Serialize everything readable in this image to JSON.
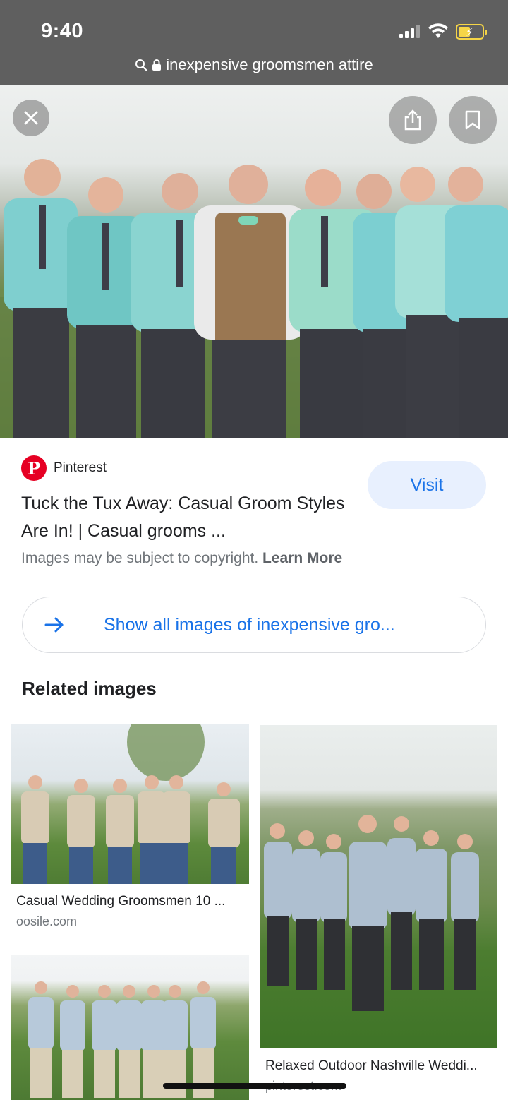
{
  "status_bar": {
    "time": "9:40"
  },
  "url_bar": {
    "text": "inexpensive groomsmen attire"
  },
  "hero": {
    "close_icon": "close-icon",
    "share_icon": "share-icon",
    "bookmark_icon": "bookmark-icon"
  },
  "result": {
    "source_name": "Pinterest",
    "visit_label": "Visit",
    "title": "Tuck the Tux Away: Casual Groom Styles Are In! | Casual grooms ...",
    "copyright_text": "Images may be subject to copyright.",
    "learn_more": "Learn More",
    "accent_color": "#1a73e8",
    "pinterest_color": "#e60023"
  },
  "show_all": {
    "label": "Show all images of inexpensive gro..."
  },
  "related": {
    "heading": "Related images",
    "items": [
      {
        "caption": "Casual Wedding Groomsmen 10 ...",
        "source": "oosile.com"
      },
      {
        "caption": "Relaxed Outdoor Nashville Weddi...",
        "source": "pinterest.com"
      },
      {
        "caption": "",
        "source": ""
      }
    ]
  }
}
